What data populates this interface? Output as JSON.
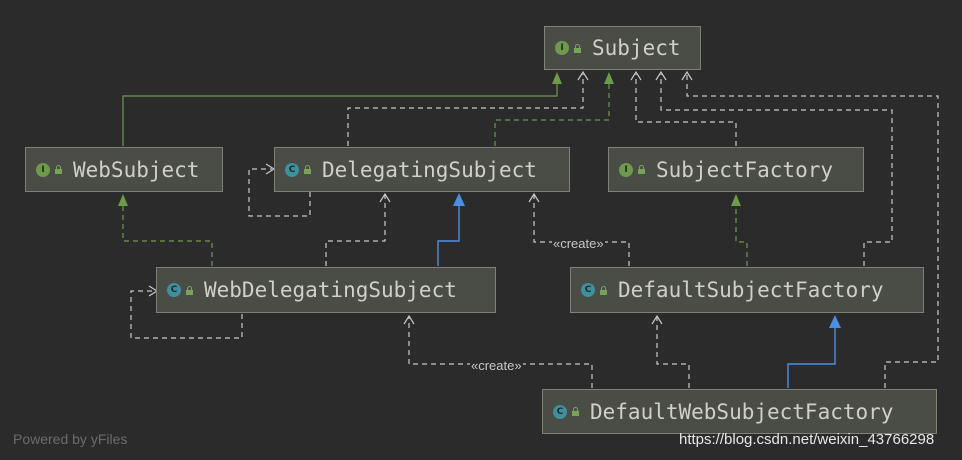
{
  "nodes": {
    "subject": {
      "kind": "I",
      "label": "Subject"
    },
    "web_subject": {
      "kind": "I",
      "label": "WebSubject"
    },
    "delegating_subject": {
      "kind": "C",
      "label": "DelegatingSubject"
    },
    "subject_factory": {
      "kind": "I",
      "label": "SubjectFactory"
    },
    "web_delegating_subject": {
      "kind": "C",
      "label": "WebDelegatingSubject"
    },
    "default_subject_factory": {
      "kind": "C",
      "label": "DefaultSubjectFactory"
    },
    "default_web_subject_factory": {
      "kind": "C",
      "label": "DefaultWebSubjectFactory"
    }
  },
  "edge_labels": {
    "create_1": "«create»",
    "create_2": "«create»"
  },
  "footer": {
    "powered_by": "Powered by yFiles",
    "watermark": "https://blog.csdn.net/weixin_43766298"
  },
  "colors": {
    "background": "#2b2b2b",
    "node_fill": "#4a4c46",
    "extends_interface": "#6e9a4b",
    "extends_class": "#4a90e2",
    "dependency": "#c8c8c8"
  }
}
